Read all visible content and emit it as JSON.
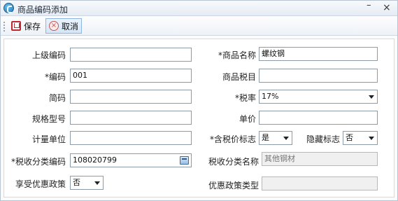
{
  "window": {
    "title": "商品编码添加",
    "minimize": "–",
    "close": "×"
  },
  "toolbar": {
    "save_label": "保存",
    "cancel_label": "取消"
  },
  "form": {
    "parent_code": {
      "label": "上级编码",
      "value": ""
    },
    "product_name": {
      "label": "*商品名称",
      "value": "螺纹钢"
    },
    "code": {
      "label": "*编码",
      "value": "001"
    },
    "product_tax_item": {
      "label": "商品税目",
      "value": ""
    },
    "short_code": {
      "label": "简码",
      "value": ""
    },
    "tax_rate": {
      "label": "*税率",
      "value": "17%"
    },
    "spec_model": {
      "label": "规格型号",
      "value": ""
    },
    "unit_price": {
      "label": "单价",
      "value": ""
    },
    "unit": {
      "label": "计量单位",
      "value": ""
    },
    "tax_included_flag": {
      "label": "*含税价标志",
      "value": "是"
    },
    "hidden_flag": {
      "label": "隐藏标志",
      "value": "否"
    },
    "tax_class_code": {
      "label": "*税收分类编码",
      "value": "108020799"
    },
    "tax_class_name": {
      "label": "税收分类名称",
      "value": "其他钢材"
    },
    "preferential_policy": {
      "label": "享受优惠政策",
      "value": "否"
    },
    "preferential_policy_type": {
      "label": "优惠政策类型",
      "value": ""
    }
  }
}
